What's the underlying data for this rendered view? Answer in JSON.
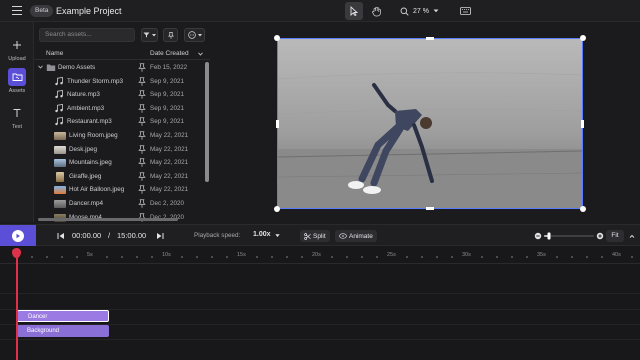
{
  "header": {
    "badge": "Beta",
    "project_title": "Example Project",
    "zoom_level": "27 %"
  },
  "left_rail": {
    "items": [
      {
        "label": "Upload",
        "icon": "plus-icon"
      },
      {
        "label": "Assets",
        "icon": "assets-folder-icon",
        "active": true
      },
      {
        "label": "Text",
        "icon": "text-icon"
      }
    ]
  },
  "assets": {
    "search_placeholder": "Search assets...",
    "columns": {
      "name": "Name",
      "date": "Date Created"
    },
    "rows": [
      {
        "name": "Demo Assets",
        "date": "Feb 15, 2022",
        "type": "folder"
      },
      {
        "name": "Thunder Storm.mp3",
        "date": "Sep 9, 2021",
        "type": "audio"
      },
      {
        "name": "Nature.mp3",
        "date": "Sep 9, 2021",
        "type": "audio"
      },
      {
        "name": "Ambient.mp3",
        "date": "Sep 9, 2021",
        "type": "audio"
      },
      {
        "name": "Restaurant.mp3",
        "date": "Sep 9, 2021",
        "type": "audio"
      },
      {
        "name": "Living Room.jpeg",
        "date": "May 22, 2021",
        "type": "image"
      },
      {
        "name": "Desk.jpeg",
        "date": "May 22, 2021",
        "type": "image"
      },
      {
        "name": "Mountains.jpeg",
        "date": "May 22, 2021",
        "type": "image"
      },
      {
        "name": "Giraffe.jpeg",
        "date": "May 22, 2021",
        "type": "image"
      },
      {
        "name": "Hot Air Balloon.jpeg",
        "date": "May 22, 2021",
        "type": "image"
      },
      {
        "name": "Dancer.mp4",
        "date": "Dec 2, 2020",
        "type": "video"
      },
      {
        "name": "Moose.mp4",
        "date": "Dec 2, 2020",
        "type": "video"
      }
    ]
  },
  "playback": {
    "current_time": "00:00.00",
    "separator": "/",
    "total_time": "15:00.00",
    "speed_label": "Playback speed:",
    "speed_value": "1.00x",
    "split_label": "Split",
    "animate_label": "Animate",
    "fit_label": "Fit",
    "timeline_zoom_fraction": 0.1
  },
  "timeline": {
    "ticks": [
      "5s",
      "10s",
      "15s",
      "20s",
      "25s",
      "30s",
      "35s",
      "40s"
    ],
    "clips": [
      {
        "label": "Dancer",
        "color": "#9b7be3"
      },
      {
        "label": "Background",
        "color": "#8a6fd6"
      }
    ]
  },
  "colors": {
    "accent": "#5a4fd6",
    "selection": "#5a7cff",
    "playhead": "#e0314a"
  }
}
